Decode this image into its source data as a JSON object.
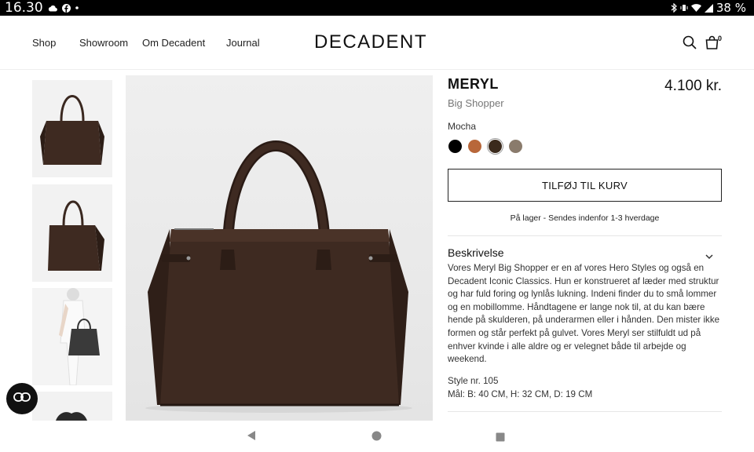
{
  "status_bar": {
    "time": "16.30",
    "battery": "38 %"
  },
  "header": {
    "nav": [
      "Shop",
      "Showroom",
      "Om Decadent",
      "Journal"
    ],
    "logo": "DECADENT",
    "cart_count": "0"
  },
  "product": {
    "name": "MERYL",
    "subtitle": "Big Shopper",
    "price": "4.100 kr.",
    "color_label": "Mocha",
    "swatches": [
      {
        "color": "#000000"
      },
      {
        "color": "#b8673a"
      },
      {
        "color": "#3b2a1c"
      },
      {
        "color": "#8a7b6c"
      }
    ],
    "add_to_cart": "TILFØJ TIL KURV",
    "stock_text": "På lager - Sendes indenfor 1-3 hverdage",
    "description_title": "Beskrivelse",
    "description": "Vores Meryl Big Shopper er en af vores Hero Styles og også en Decadent Iconic Classics. Hun er konstrueret af læder med struktur og har fuld foring og lynlås lukning. Indeni finder du to små lommer og en mobillomme. Håndtagene er lange nok til, at du kan bære hende på skulderen, på underarmen eller i hånden. Den mister ikke formen og står perfekt på gulvet. Vores Meryl ser stilfuldt ud på enhver kvinde i alle aldre og er velegnet både til arbejde og weekend.",
    "style_no": "Style nr. 105",
    "dimensions": "Mål: B: 40 CM, H: 32 CM, D: 19 CM"
  },
  "colors": {
    "bag": "#3e2a21",
    "bag_dark": "#2c1d16",
    "bag_light": "#4a3328"
  }
}
